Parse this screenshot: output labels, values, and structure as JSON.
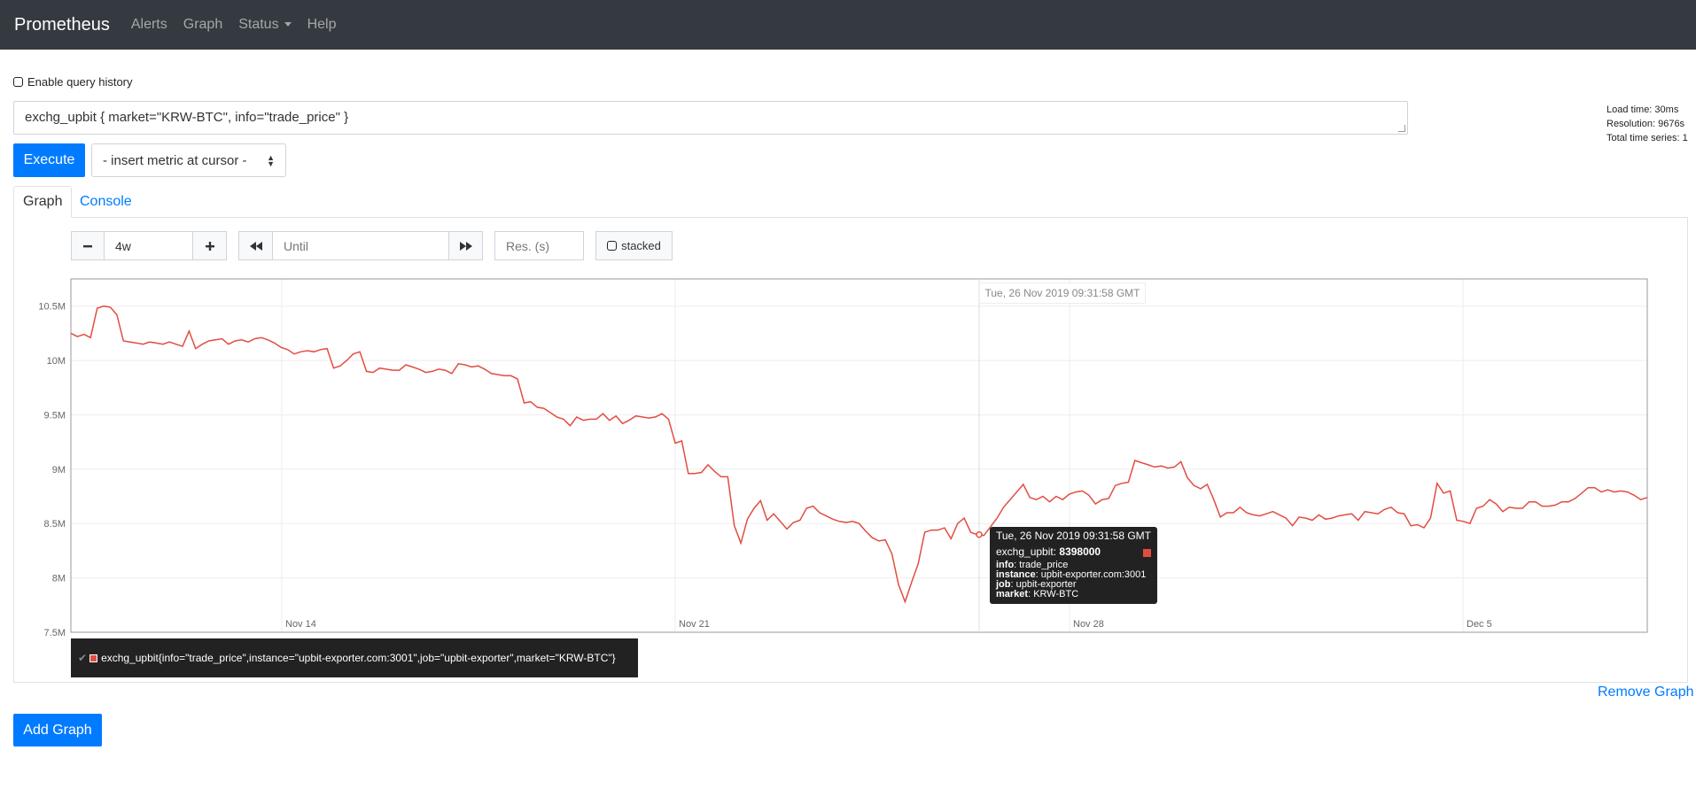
{
  "navbar": {
    "brand": "Prometheus",
    "links": [
      "Alerts",
      "Graph",
      "Status",
      "Help"
    ]
  },
  "query_history": {
    "label": "Enable query history",
    "checked": false
  },
  "expression": {
    "value": "exchg_upbit { market=\"KRW-BTC\", info=\"trade_price\" }"
  },
  "stats": {
    "load_time": "Load time: 30ms",
    "resolution": "Resolution: 9676s",
    "total_series": "Total time series: 1"
  },
  "controls": {
    "execute_label": "Execute",
    "metric_select": "- insert metric at cursor -",
    "tabs": [
      "Graph",
      "Console"
    ],
    "range_value": "4w",
    "until_placeholder": "Until",
    "resolution_placeholder": "Res. (s)",
    "stacked_label": "stacked",
    "remove_graph": "Remove Graph",
    "add_graph": "Add Graph"
  },
  "colors": {
    "series": "#e24d42",
    "primary": "#007bff",
    "navbar": "#343a40"
  },
  "chart_data": {
    "type": "line",
    "ylim": [
      7500000,
      10750000
    ],
    "y_ticks": [
      "10.5M",
      "10M",
      "9.5M",
      "9M",
      "8.5M",
      "8M",
      "7.5M"
    ],
    "x_ticks": [
      "Nov 14",
      "Nov 21",
      "Nov 28",
      "Dec 5"
    ],
    "grid": true,
    "series": [
      {
        "name": "exchg_upbit{info=\"trade_price\",instance=\"upbit-exporter.com:3001\",job=\"upbit-exporter\",market=\"KRW-BTC\"}",
        "values": [
          10250000,
          10220000,
          10240000,
          10210000,
          10480000,
          10500000,
          10490000,
          10420000,
          10180000,
          10170000,
          10160000,
          10150000,
          10170000,
          10160000,
          10150000,
          10170000,
          10150000,
          10130000,
          10270000,
          10110000,
          10150000,
          10180000,
          10190000,
          10200000,
          10150000,
          10180000,
          10190000,
          10170000,
          10200000,
          10210000,
          10190000,
          10160000,
          10120000,
          10100000,
          10060000,
          10080000,
          10090000,
          10080000,
          10100000,
          10110000,
          9930000,
          9950000,
          10000000,
          10060000,
          10080000,
          9900000,
          9890000,
          9930000,
          9920000,
          9910000,
          9910000,
          9960000,
          9940000,
          9920000,
          9890000,
          9900000,
          9920000,
          9910000,
          9880000,
          9970000,
          9960000,
          9940000,
          9950000,
          9920000,
          9880000,
          9870000,
          9860000,
          9860000,
          9830000,
          9610000,
          9620000,
          9570000,
          9560000,
          9520000,
          9480000,
          9460000,
          9400000,
          9480000,
          9450000,
          9460000,
          9460000,
          9510000,
          9450000,
          9490000,
          9420000,
          9450000,
          9490000,
          9480000,
          9470000,
          9480000,
          9510000,
          9460000,
          9240000,
          9260000,
          8960000,
          8960000,
          8970000,
          9040000,
          8980000,
          8930000,
          8930000,
          8480000,
          8320000,
          8540000,
          8640000,
          8710000,
          8530000,
          8590000,
          8520000,
          8450000,
          8510000,
          8530000,
          8640000,
          8660000,
          8600000,
          8570000,
          8540000,
          8520000,
          8510000,
          8520000,
          8500000,
          8430000,
          8370000,
          8340000,
          8350000,
          8220000,
          7940000,
          7780000,
          7960000,
          8130000,
          8420000,
          8440000,
          8440000,
          8460000,
          8360000,
          8500000,
          8550000,
          8420000,
          8398000,
          8390000,
          8470000,
          8550000,
          8650000,
          8720000,
          8790000,
          8860000,
          8740000,
          8720000,
          8750000,
          8700000,
          8750000,
          8720000,
          8770000,
          8790000,
          8800000,
          8760000,
          8680000,
          8720000,
          8730000,
          8850000,
          8870000,
          8880000,
          9080000,
          9060000,
          9040000,
          9020000,
          9030000,
          9010000,
          9020000,
          9070000,
          8920000,
          8850000,
          8820000,
          8860000,
          8720000,
          8560000,
          8600000,
          8600000,
          8650000,
          8600000,
          8580000,
          8570000,
          8590000,
          8610000,
          8580000,
          8550000,
          8480000,
          8560000,
          8550000,
          8530000,
          8580000,
          8540000,
          8550000,
          8570000,
          8580000,
          8590000,
          8530000,
          8610000,
          8600000,
          8590000,
          8630000,
          8650000,
          8600000,
          8590000,
          8480000,
          8490000,
          8460000,
          8550000,
          8870000,
          8780000,
          8800000,
          8530000,
          8520000,
          8500000,
          8640000,
          8660000,
          8720000,
          8680000,
          8610000,
          8650000,
          8640000,
          8640000,
          8700000,
          8700000,
          8660000,
          8660000,
          8670000,
          8700000,
          8700000,
          8730000,
          8780000,
          8830000,
          8830000,
          8790000,
          8810000,
          8790000,
          8800000,
          8790000,
          8760000,
          8720000,
          8740000
        ]
      }
    ],
    "hover": {
      "time": "Tue, 26 Nov 2019 09:31:58 GMT",
      "metric": "exchg_upbit",
      "value": "8398000",
      "labels": [
        {
          "key": "info",
          "value": "trade_price"
        },
        {
          "key": "instance",
          "value": "upbit-exporter.com:3001"
        },
        {
          "key": "job",
          "value": "upbit-exporter"
        },
        {
          "key": "market",
          "value": "KRW-BTC"
        }
      ]
    }
  }
}
